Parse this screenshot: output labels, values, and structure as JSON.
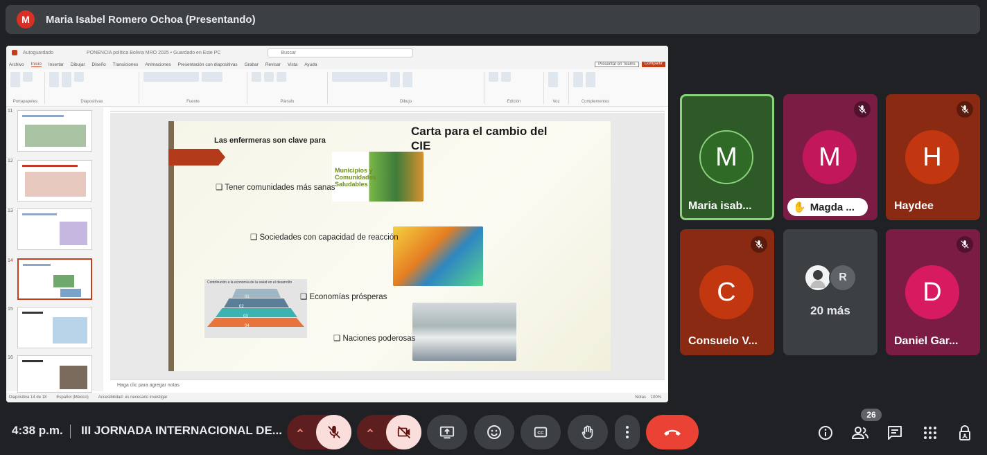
{
  "presenter": {
    "initial": "M",
    "name": "Maria Isabel Romero Ochoa (Presentando)"
  },
  "ppt": {
    "titlebar": "PONENCIA política Bolivia MRO 2025 • Guardado en Este PC",
    "autosave": "Autoguardado",
    "search_placeholder": "Buscar",
    "tabs": [
      "Archivo",
      "Inicio",
      "Insertar",
      "Dibujar",
      "Diseño",
      "Transiciones",
      "Animaciones",
      "Presentación con diapositivas",
      "Grabar",
      "Revisar",
      "Vista",
      "Ayuda"
    ],
    "present_label": "Presentar en Teams",
    "share_label": "Compartir",
    "ribbon_groups": [
      "Portapapeles",
      "Diapositivas",
      "Fuente",
      "Párrafo",
      "Dibujo",
      "Edición",
      "Voz",
      "Complementos"
    ],
    "thumb_numbers": [
      "11",
      "12",
      "13",
      "14",
      "15",
      "16"
    ],
    "notes_placeholder": "Haga clic para agregar notas",
    "status_left": "Diapositiva 14 de 18",
    "status_lang": "Español (México)",
    "status_access": "Accesibilidad: es necesario investigar",
    "status_notes": "Notas",
    "status_zoom": "100%"
  },
  "slide": {
    "title": "Carta para el cambio del CIE",
    "subtitle": "Las enfermeras son clave para",
    "bullets": [
      "❑ Tener comunidades más sanas",
      "❑ Sociedades con capacidad de reacción",
      "❑ Economías prósperas",
      "❑ Naciones poderosas"
    ],
    "image1_text": "Municipios y Comunidades Saludables",
    "pyramid_title": "Contribución a la economía de la salud en el desarrollo",
    "pyramid_levels": [
      "01",
      "02",
      "03",
      "04"
    ]
  },
  "tiles": [
    {
      "initial": "M",
      "name": "Maria isab...",
      "color": "#2d5a27"
    },
    {
      "initial": "M",
      "name": "Magda ...",
      "color": "#8b1d4a"
    },
    {
      "initial": "H",
      "name": "Haydee",
      "color": "#9c2a10"
    },
    {
      "initial": "C",
      "name": "Consuelo V...",
      "color": "#9c2a10"
    },
    {
      "name": "20 más",
      "second_initial": "R"
    },
    {
      "initial": "D",
      "name": "Daniel Gar...",
      "color": "#8b1d4a"
    }
  ],
  "bottom": {
    "time": "4:38 p.m.",
    "meeting_title": "III JORNADA INTERNACIONAL DE...",
    "people_count": "26"
  },
  "colors": {
    "accent_red": "#ea4335",
    "mute_bg": "#f9dedc",
    "end_call": "#ea4335"
  }
}
